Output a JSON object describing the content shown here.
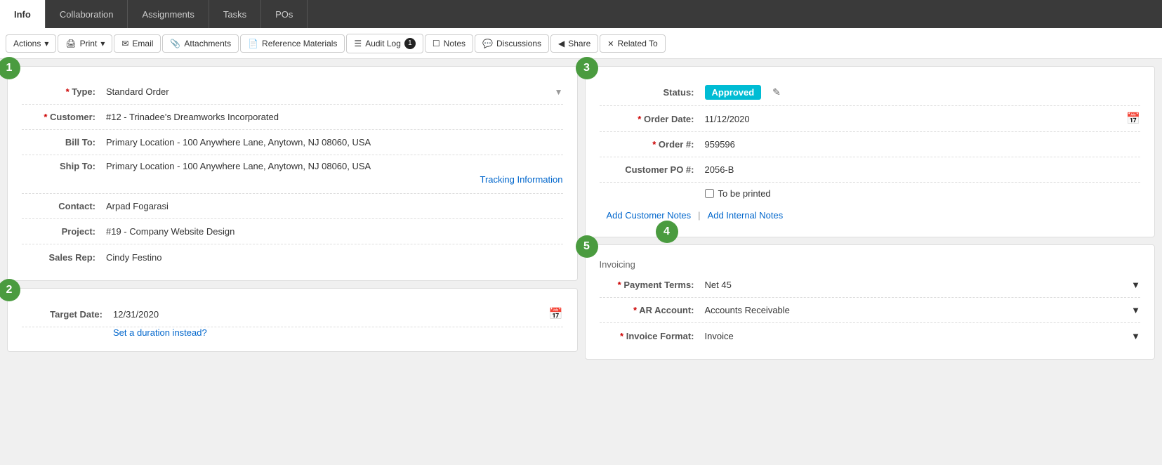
{
  "top_tabs": [
    {
      "id": "info",
      "label": "Info",
      "active": true
    },
    {
      "id": "collaboration",
      "label": "Collaboration",
      "active": false
    },
    {
      "id": "assignments",
      "label": "Assignments",
      "active": false
    },
    {
      "id": "tasks",
      "label": "Tasks",
      "active": false
    },
    {
      "id": "pos",
      "label": "POs",
      "active": false
    }
  ],
  "action_bar": {
    "actions_label": "Actions",
    "print_label": "Print",
    "email_label": "Email",
    "attachments_label": "Attachments",
    "reference_materials_label": "Reference Materials",
    "audit_log_label": "Audit Log",
    "audit_log_badge": "1",
    "notes_label": "Notes",
    "discussions_label": "Discussions",
    "share_label": "Share",
    "related_to_label": "Related To"
  },
  "section1": {
    "step": "1",
    "type_label": "Type:",
    "type_value": "Standard Order",
    "customer_label": "Customer:",
    "customer_value": "#12 - Trinadee's Dreamworks Incorporated",
    "bill_to_label": "Bill To:",
    "bill_to_value": "Primary Location - 100 Anywhere Lane, Anytown, NJ 08060, USA",
    "ship_to_label": "Ship To:",
    "ship_to_value": "Primary Location - 100 Anywhere Lane, Anytown, NJ 08060, USA",
    "tracking_link": "Tracking Information",
    "contact_label": "Contact:",
    "contact_value": "Arpad Fogarasi",
    "project_label": "Project:",
    "project_value": "#19 -  Company Website Design",
    "sales_rep_label": "Sales Rep:",
    "sales_rep_value": "Cindy Festino"
  },
  "section2": {
    "step": "2",
    "target_date_label": "Target Date:",
    "target_date_value": "12/31/2020",
    "duration_link": "Set a duration instead?"
  },
  "section3": {
    "step": "3",
    "status_label": "Status:",
    "status_value": "Approved",
    "order_date_label": "Order Date:",
    "order_date_value": "11/12/2020",
    "order_num_label": "Order #:",
    "order_num_value": "959596",
    "customer_po_label": "Customer PO #:",
    "customer_po_value": "2056-B",
    "to_be_printed_label": "To be printed",
    "add_customer_notes": "Add Customer Notes",
    "notes_separator": "|",
    "add_internal_notes": "Add Internal Notes"
  },
  "section4": {
    "step": "4",
    "invoicing_title": "Invoicing"
  },
  "section5": {
    "step": "5",
    "payment_terms_label": "Payment Terms:",
    "payment_terms_value": "Net 45",
    "ar_account_label": "AR Account:",
    "ar_account_value": "Accounts Receivable",
    "invoice_format_label": "Invoice Format:",
    "invoice_format_value": "Invoice"
  }
}
